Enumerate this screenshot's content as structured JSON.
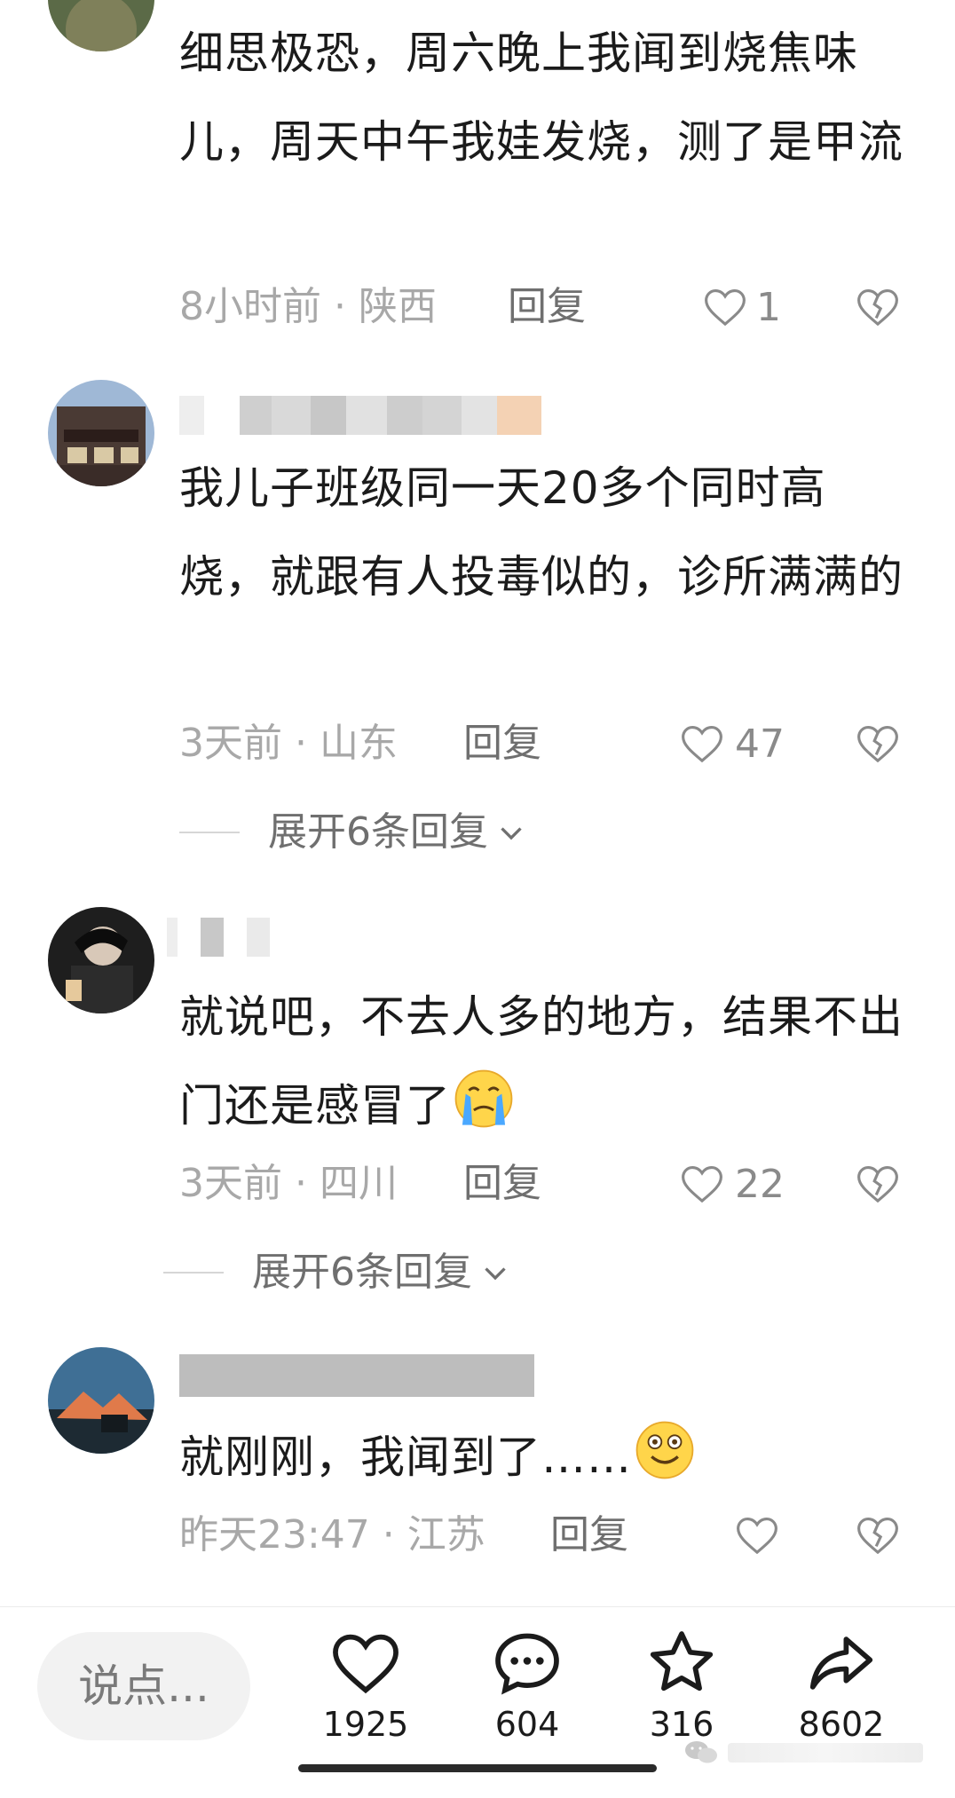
{
  "comments": [
    {
      "text": "细思极恐，周六晚上我闻到烧焦味儿，周天中午我娃发烧，测了是甲流",
      "meta": "8小时前 · 陕西",
      "reply": "回复",
      "likes": "1"
    },
    {
      "text": "我儿子班级同一天20多个同时高烧，就跟有人投毒似的，诊所满满的",
      "meta": "3天前 · 山东",
      "reply": "回复",
      "likes": "47",
      "expand": "展开6条回复"
    },
    {
      "text": "就说吧，不去人多的地方，结果不出门还是感冒了",
      "meta": "3天前 · 四川",
      "reply": "回复",
      "likes": "22",
      "expand": "展开6条回复"
    },
    {
      "text": "就刚刚，我闻到了……",
      "meta": "昨天23:47 · 江苏",
      "reply": "回复",
      "likes": ""
    }
  ],
  "bottom_bar": {
    "input_placeholder": "说点...",
    "like_count": "1925",
    "comment_count": "604",
    "favorite_count": "316",
    "share_count": "8602"
  },
  "icons": {
    "like": "heart-outline-icon",
    "dislike": "broken-heart-icon",
    "comment": "speech-bubble-icon",
    "favorite": "star-outline-icon",
    "share": "share-arrow-icon",
    "expand": "chevron-down-icon",
    "watermark": "wechat-icon"
  },
  "colors": {
    "text": "#1b1b1b",
    "meta": "#a8a8a8",
    "action_gray": "#6f6f6f",
    "input_bg": "#f2f2f2"
  }
}
